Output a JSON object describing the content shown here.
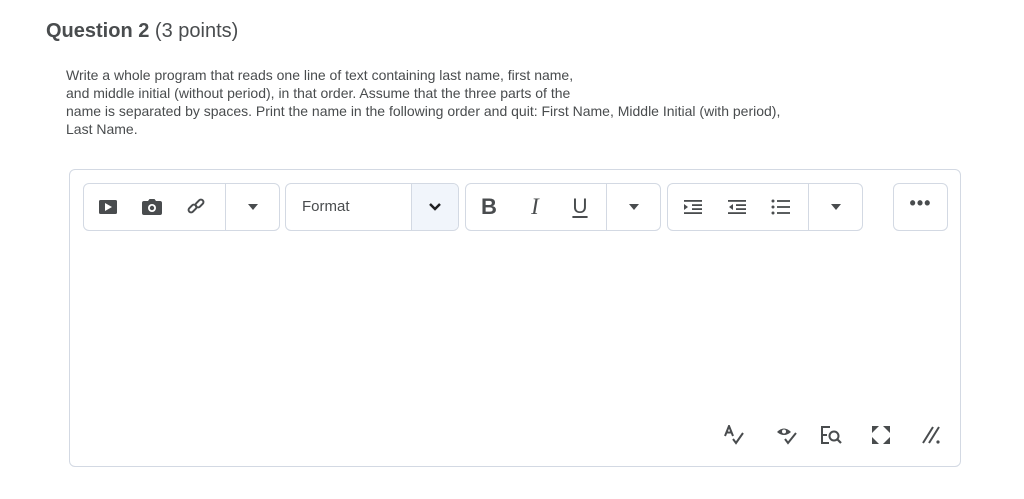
{
  "question": {
    "number": "Question 2",
    "points": "(3 points)",
    "prompt_lines": [
      "Write a whole program that reads one line of text containing last name, first name,",
      "and middle initial (without period), in that order. Assume that the three parts of the",
      "name is separated by spaces. Print the name in the following order and quit: First Name, Middle Initial (with period),",
      "Last Name."
    ]
  },
  "toolbar": {
    "insert_group": {
      "icons": [
        "video-play-icon",
        "camera-icon",
        "link-icon",
        "chevron-down-icon"
      ]
    },
    "format_select": {
      "label": "Format"
    },
    "text_group": {
      "bold": "B",
      "italic": "I",
      "underline": "U"
    },
    "list_group": {
      "icons": [
        "indent-icon",
        "outdent-icon",
        "bullet-list-icon",
        "chevron-down-icon"
      ]
    },
    "more": {
      "label": "•••"
    }
  },
  "editor": {
    "value": ""
  },
  "bottom_tools": [
    "spellcheck-icon",
    "accessibility-checker-icon",
    "preview-icon",
    "fullscreen-icon",
    "resize-handle-icon"
  ]
}
